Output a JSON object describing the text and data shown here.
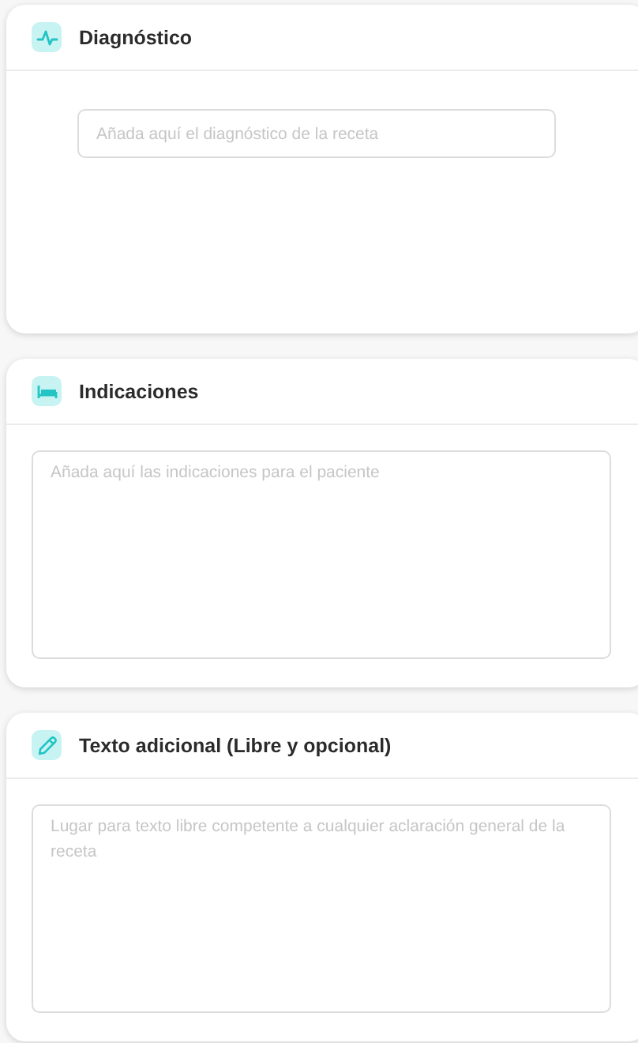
{
  "sections": [
    {
      "title": "Diagnóstico",
      "kind": "line",
      "placeholder": "Añada aquí el diagnóstico de la receta"
    },
    {
      "title": "Indicaciones",
      "kind": "area",
      "placeholder": "Añada aquí las indicaciones para el paciente"
    },
    {
      "title": "Texto adicional (Libre y opcional)",
      "kind": "area",
      "placeholder": "Lugar para texto libre competente a cualquier aclaración general de la receta"
    }
  ]
}
